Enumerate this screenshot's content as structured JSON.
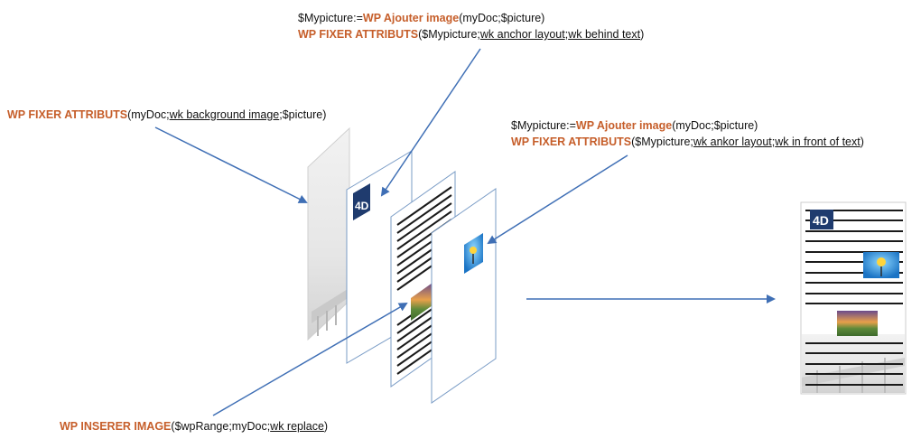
{
  "diagram": {
    "top_caption": {
      "line1": {
        "var": "$Mypicture:=",
        "cmd": "WP Ajouter image",
        "args": "(myDoc;$picture)"
      },
      "line2": {
        "cmd": "WP FIXER ATTRIBUTS",
        "pre": "($Mypicture;",
        "opt1": "wk anchor layout",
        "sep": ";",
        "opt2": "wk behind text",
        "post": ")"
      }
    },
    "left_caption": {
      "cmd": "WP FIXER ATTRIBUTS",
      "pre": "(myDoc;",
      "opt1": "wk background image",
      "post": ";$picture)"
    },
    "right_caption": {
      "line1": {
        "var": "$Mypicture:=",
        "cmd": "WP Ajouter image",
        "args": "(myDoc;$picture)"
      },
      "line2": {
        "cmd": "WP FIXER ATTRIBUTS",
        "pre": "($Mypicture;",
        "opt1": "wk ankor layout",
        "sep": ";",
        "opt2": "wk in front of text",
        "post": ")"
      }
    },
    "bottom_caption": {
      "cmd": "WP INSERER IMAGE",
      "pre": "($wpRange;myDoc;",
      "opt1": "wk replace",
      "post": ")"
    },
    "logo_text": "4D",
    "colors": {
      "keyword": "#c65e2a",
      "arrow": "#3f6fb5",
      "page_border": "#7a9cc6"
    }
  }
}
